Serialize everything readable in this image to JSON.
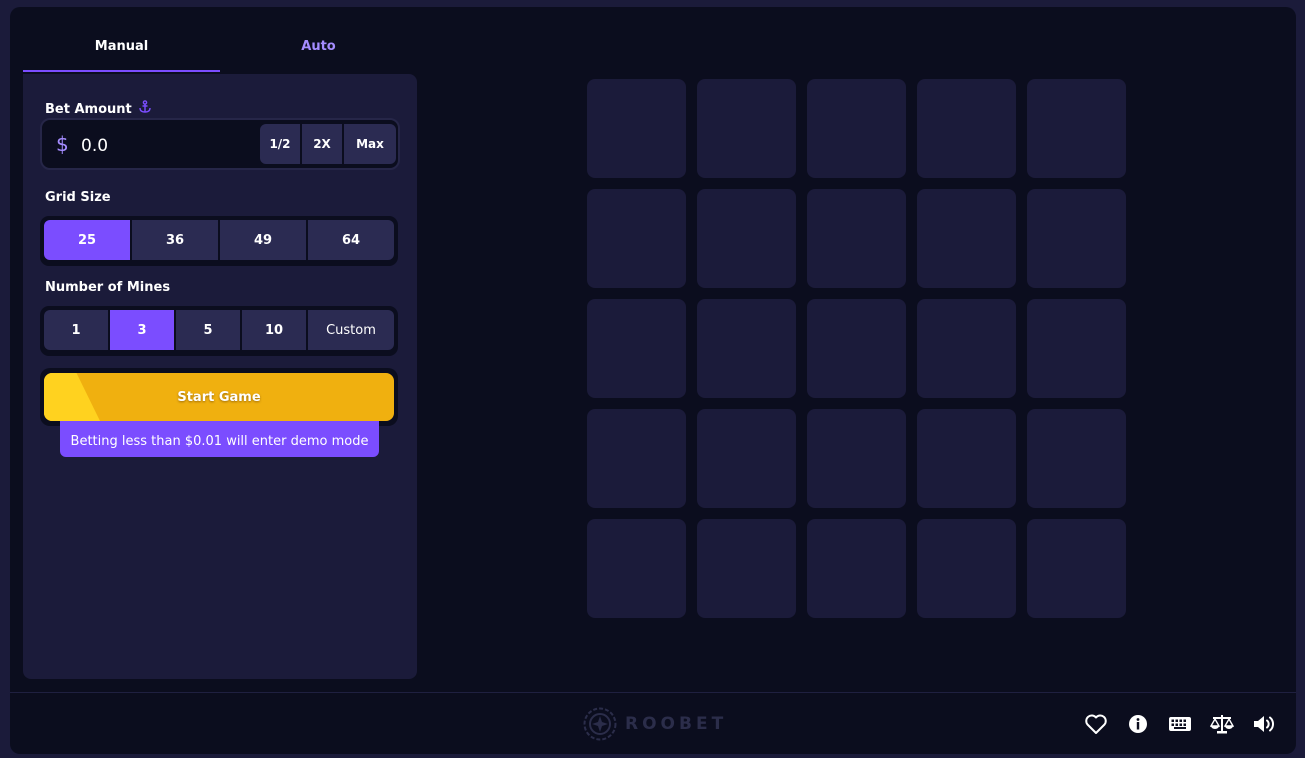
{
  "tabs": [
    {
      "label": "Manual"
    },
    {
      "label": "Auto"
    }
  ],
  "bet": {
    "label": "Bet Amount",
    "currency_symbol": "$",
    "value": "0.0",
    "half_label": "1/2",
    "double_label": "2X",
    "max_label": "Max"
  },
  "grid_size": {
    "label": "Grid Size",
    "options": [
      "25",
      "36",
      "49",
      "64"
    ],
    "selected": "25"
  },
  "mines": {
    "label": "Number of Mines",
    "options": [
      "1",
      "3",
      "5",
      "10",
      "Custom"
    ],
    "selected": "3"
  },
  "start_button": {
    "label": "Start Game"
  },
  "demo_notice": "Betting less than $0.01 will enter demo mode",
  "board": {
    "rows": 5,
    "columns": 5
  },
  "footer": {
    "logo_text": "ROOBET",
    "icons": [
      "heart-icon",
      "info-icon",
      "keyboard-icon",
      "scales-icon",
      "volume-icon"
    ]
  },
  "colors": {
    "accent": "#7b4dff",
    "start": "#f0b00f",
    "panel": "#1b1b3a",
    "background": "#0b0d1e"
  }
}
